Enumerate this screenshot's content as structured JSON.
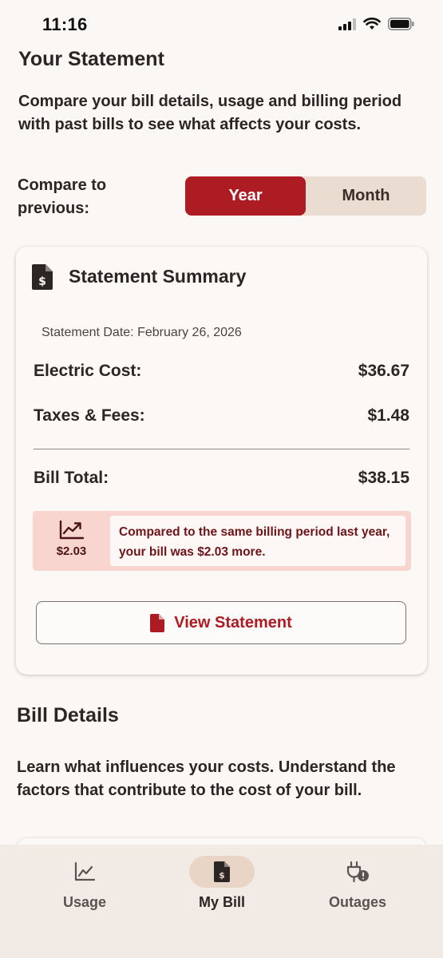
{
  "status": {
    "time": "11:16"
  },
  "header": {
    "title": "Your Statement",
    "intro": "Compare your bill details, usage and billing period with past bills to see what affects your costs."
  },
  "compare": {
    "label": "Compare to previous:",
    "options": [
      "Year",
      "Month"
    ],
    "selected": "Year"
  },
  "summary": {
    "title": "Statement Summary",
    "date_label": "Statement Date:",
    "date": "February 26, 2026",
    "rows": [
      {
        "label": "Electric Cost:",
        "value": "$36.67"
      },
      {
        "label": "Taxes & Fees:",
        "value": "$1.48"
      }
    ],
    "total": {
      "label": "Bill Total:",
      "value": "$38.15"
    },
    "notice": {
      "amount": "$2.03",
      "text": "Compared to the same billing period last year, your bill was $2.03 more."
    },
    "view_button": "View Statement"
  },
  "bill_details": {
    "title": "Bill Details",
    "text": "Learn what influences your costs. Understand the factors that contribute to the cost of your bill."
  },
  "tabs": [
    {
      "label": "Usage",
      "icon": "chart-line-icon"
    },
    {
      "label": "My Bill",
      "icon": "bill-icon",
      "active": true
    },
    {
      "label": "Outages",
      "icon": "plug-alert-icon"
    }
  ],
  "colors": {
    "accent": "#ad1c22",
    "notice_bg": "#f9d5d0",
    "segment_bg": "#eadcd0"
  }
}
